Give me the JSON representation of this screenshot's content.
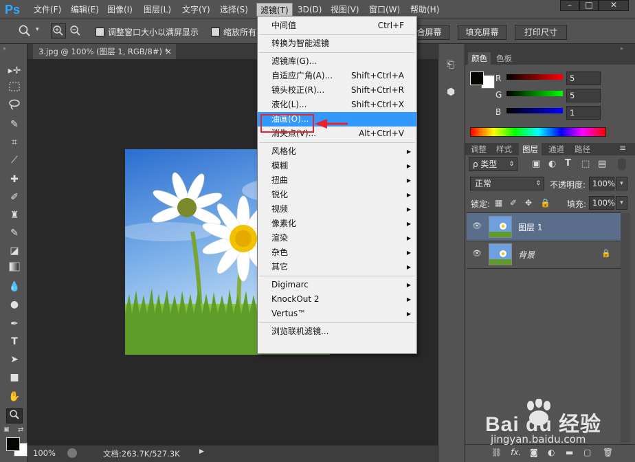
{
  "app": {
    "logo": "Ps"
  },
  "menubar": {
    "items": [
      "文件(F)",
      "编辑(E)",
      "图像(I)",
      "图层(L)",
      "文字(Y)",
      "选择(S)",
      "滤镜(T)",
      "3D(D)",
      "视图(V)",
      "窗口(W)",
      "帮助(H)"
    ],
    "active": "滤镜(T)",
    "window_controls": [
      "–",
      "□",
      "✕"
    ]
  },
  "options": {
    "resize_label": "调整窗口大小以满屏显示",
    "zoom_all_label": "缩放所有",
    "fit_screen_label": "合屏幕",
    "fill_screen_label": "填充屏幕",
    "print_size_label": "打印尺寸"
  },
  "document": {
    "tab_title": "3.jpg @ 100% (图层 1, RGB/8#) *",
    "tab_close": "×"
  },
  "status": {
    "zoom": "100%",
    "doc_size": "文档:263.7K/527.3K"
  },
  "filter_menu": {
    "groups": [
      [
        {
          "label": "中间值",
          "shortcut": "Ctrl+F"
        }
      ],
      [
        {
          "label": "转换为智能滤镜",
          "shortcut": ""
        }
      ],
      [
        {
          "label": "滤镜库(G)...",
          "shortcut": ""
        },
        {
          "label": "自适应广角(A)...",
          "shortcut": "Shift+Ctrl+A"
        },
        {
          "label": "镜头校正(R)...",
          "shortcut": "Shift+Ctrl+R"
        },
        {
          "label": "液化(L)...",
          "shortcut": "Shift+Ctrl+X"
        },
        {
          "label": "油画(O)...",
          "shortcut": "",
          "highlighted": true
        },
        {
          "label": "消失点(V)...",
          "shortcut": "Alt+Ctrl+V"
        }
      ],
      [
        {
          "label": "风格化",
          "submenu": true
        },
        {
          "label": "模糊",
          "submenu": true
        },
        {
          "label": "扭曲",
          "submenu": true
        },
        {
          "label": "锐化",
          "submenu": true
        },
        {
          "label": "视频",
          "submenu": true
        },
        {
          "label": "像素化",
          "submenu": true
        },
        {
          "label": "渲染",
          "submenu": true
        },
        {
          "label": "杂色",
          "submenu": true
        },
        {
          "label": "其它",
          "submenu": true
        }
      ],
      [
        {
          "label": "Digimarc",
          "submenu": true
        },
        {
          "label": "KnockOut 2",
          "submenu": true
        },
        {
          "label": "Vertus™",
          "submenu": true
        }
      ],
      [
        {
          "label": "浏览联机滤镜...",
          "shortcut": ""
        }
      ]
    ]
  },
  "color_panel": {
    "tabs": [
      "颜色",
      "色板"
    ],
    "channels": [
      {
        "name": "R",
        "value": "5"
      },
      {
        "name": "G",
        "value": "5"
      },
      {
        "name": "B",
        "value": "1"
      }
    ]
  },
  "layers_panel": {
    "tabs": [
      "调整",
      "样式",
      "图层",
      "通道",
      "路径"
    ],
    "active_tab": "图层",
    "filter_label": "ρ 类型",
    "blend_mode": "正常",
    "opacity_label": "不透明度:",
    "opacity_value": "100%",
    "lock_label": "锁定:",
    "fill_label": "填充:",
    "fill_value": "100%",
    "layers": [
      {
        "name": "图层 1",
        "selected": true
      },
      {
        "name": "背景",
        "selected": false,
        "locked": true
      }
    ]
  },
  "watermark": {
    "brand": "Bai du 经验",
    "url": "jingyan.baidu.com"
  },
  "colors": {
    "accent": "#3399ff",
    "highlight_box": "#e8232a",
    "panel": "#535353",
    "canvas": "#282828"
  }
}
